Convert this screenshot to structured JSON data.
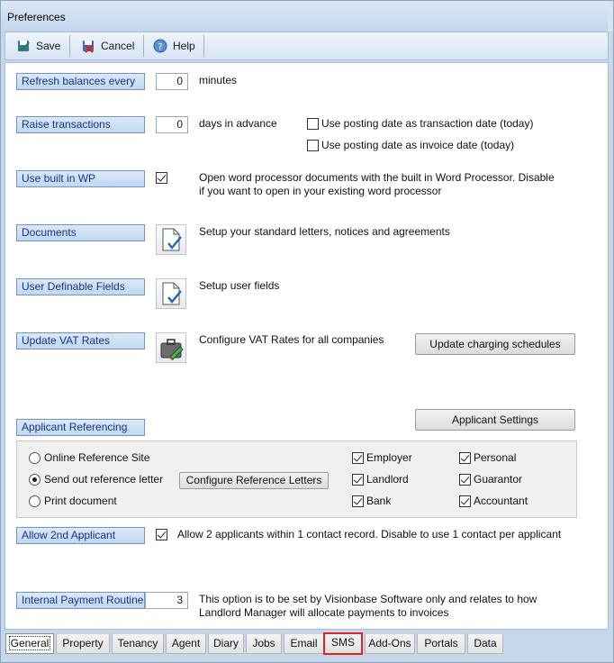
{
  "window": {
    "title": "Preferences"
  },
  "toolbar": {
    "save_label": "Save",
    "cancel_label": "Cancel",
    "help_label": "Help"
  },
  "settings": {
    "refresh": {
      "label": "Refresh balances every",
      "value": "0",
      "unit": "minutes"
    },
    "raise": {
      "label": "Raise transactions",
      "value": "0",
      "unit": "days in advance",
      "opt1": "Use posting date as transaction date  (today)",
      "opt2": "Use posting date as invoice date  (today)"
    },
    "wp": {
      "label": "Use built in WP",
      "desc1": "Open word processor documents with the built in Word Processor. Disable",
      "desc2": "if you want to open in your existing word processor"
    },
    "documents": {
      "label": "Documents",
      "desc": "Setup your standard letters, notices and agreements"
    },
    "udf": {
      "label": "User Definable Fields",
      "desc": "Setup user fields"
    },
    "vat": {
      "label": "Update VAT Rates",
      "desc": "Configure VAT Rates for all companies",
      "schedules_button": "Update charging schedules"
    },
    "applicant": {
      "label": "Applicant Referencing",
      "settings_button": "Applicant Settings",
      "radio_online": "Online Reference Site",
      "radio_send": "Send out reference letter",
      "radio_print": "Print document",
      "configure_button": "Configure Reference Letters",
      "chk_employer": "Employer",
      "chk_personal": "Personal",
      "chk_landlord": "Landlord",
      "chk_guarantor": "Guarantor",
      "chk_bank": "Bank",
      "chk_accountant": "Accountant"
    },
    "second_applicant": {
      "label": "Allow 2nd Applicant",
      "desc": "Allow 2 applicants within 1 contact record. Disable to use 1 contact per applicant"
    },
    "payment": {
      "label": "Internal Payment Routine",
      "value": "3",
      "desc1": "This option is to be set by Visionbase Software only and relates to how",
      "desc2": "Landlord Manager will allocate payments to invoices"
    }
  },
  "tabs": [
    "General",
    "Property",
    "Tenancy",
    "Agent",
    "Diary",
    "Jobs",
    "Email",
    "SMS",
    "Add-Ons",
    "Portals",
    "Data"
  ],
  "colors": {
    "label_text": "#12338b",
    "highlight": "#d9262a"
  }
}
